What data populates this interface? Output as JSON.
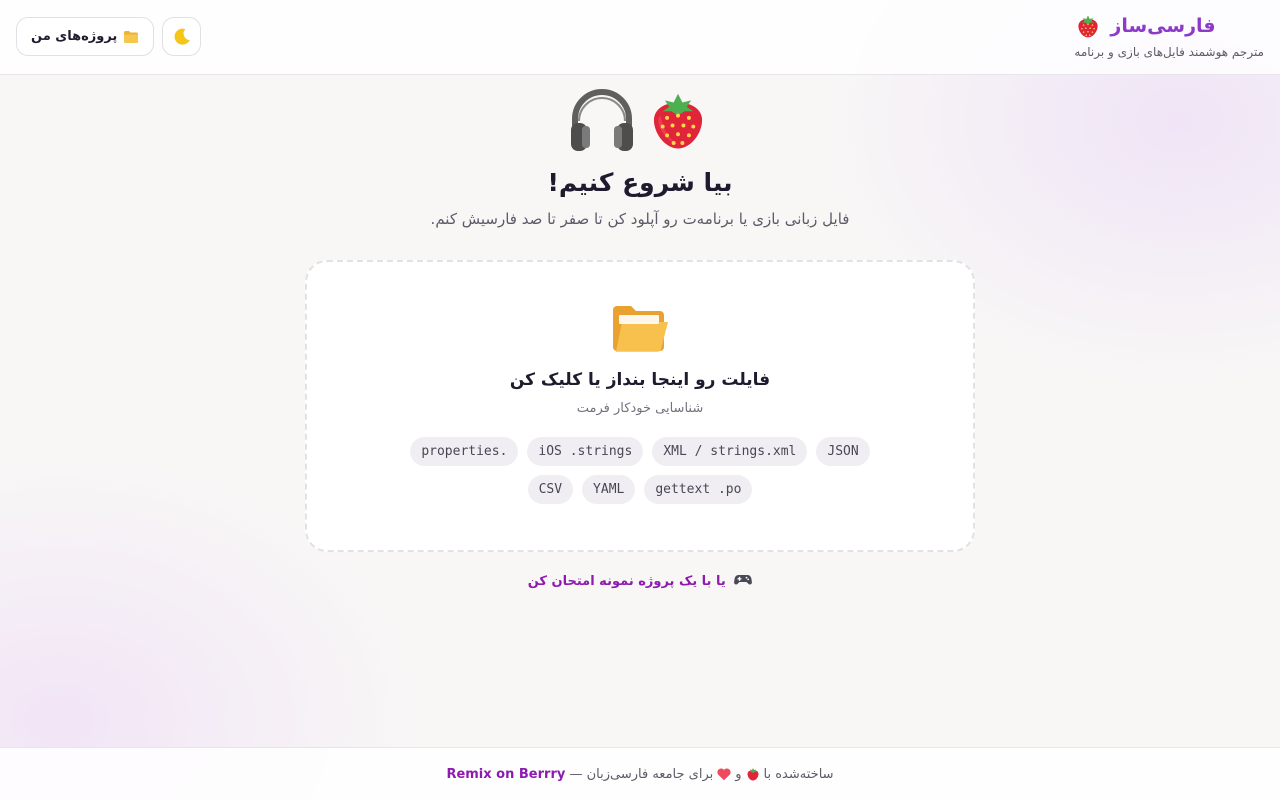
{
  "header": {
    "app_name": "فارسی‌ساز",
    "tagline": "مترجم هوشمند فایل‌های بازی و برنامه",
    "logo_icon": "strawberry-icon",
    "projects_icon": "folder-icon",
    "projects_label": "پروژه‌های من",
    "theme_icon": "crescent-moon-icon"
  },
  "hero": {
    "icons": [
      "headphones-icon",
      "strawberry-icon"
    ],
    "title": "بیا شروع کنیم!",
    "subtitle": "فایل زبانی بازی یا برنامه‌ت رو آپلود کن تا صفر تا صد فارسیش کنم."
  },
  "dropzone": {
    "icon": "open-folder-icon",
    "title": "فایلت رو اینجا بنداز یا کلیک کن",
    "subtitle": "شناسایی خودکار فرمت",
    "formats": [
      "JSON",
      "XML / strings.xml",
      "iOS .strings",
      "properties.",
      "gettext .po",
      "YAML",
      "CSV"
    ]
  },
  "sample": {
    "icon": "game-controller-icon",
    "label": "یا با یک پروژه نمونه امتحان کن"
  },
  "footer": {
    "made_with": "ساخته‌شده با",
    "and": "و",
    "for_community": "برای جامعه فارسی‌زبان —",
    "link_text": "Remix on Berrry",
    "icons": [
      "strawberry-icon",
      "heart-icon"
    ]
  },
  "colors": {
    "brand": "#8e3ac9",
    "link": "#8e1bb0",
    "text": "#1e1b2e",
    "muted": "#5e5a68",
    "chip_bg": "#f0eef3"
  }
}
